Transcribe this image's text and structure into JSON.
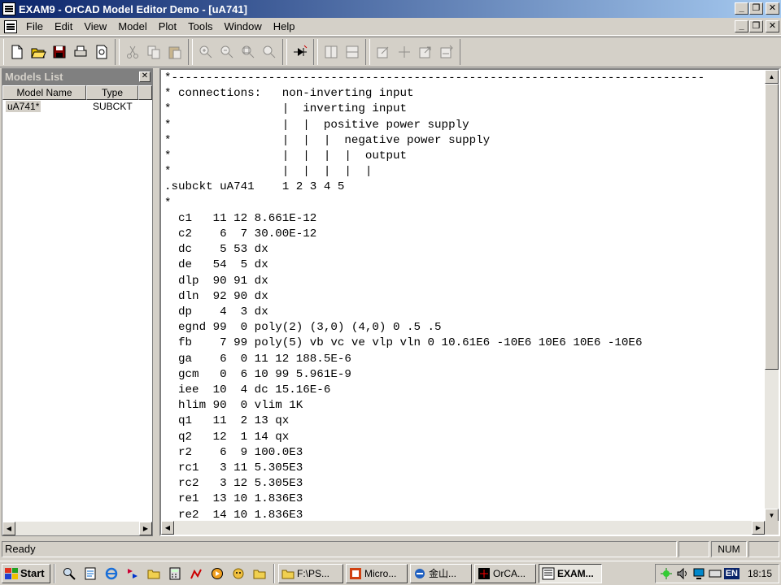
{
  "window": {
    "title": "EXAM9 - OrCAD Model Editor Demo  - [uA741]",
    "minimize": "_",
    "restore": "❐",
    "close": "✕"
  },
  "menu": [
    "File",
    "Edit",
    "View",
    "Model",
    "Plot",
    "Tools",
    "Window",
    "Help"
  ],
  "toolbar_icons": [
    "new-file-icon",
    "open-folder-icon",
    "save-icon",
    "print-icon",
    "print-preview-icon",
    "cut-icon",
    "copy-icon",
    "paste-icon",
    "zoom-in-icon",
    "zoom-out-icon",
    "zoom-area-icon",
    "zoom-fit-icon",
    "diode-model-icon",
    "split-vertical-icon",
    "split-horizontal-icon",
    "edit-trace-icon",
    "crosshair-icon",
    "extract-model-icon",
    "simulate-icon"
  ],
  "models_panel": {
    "title": "Models List",
    "close": "✕",
    "columns": [
      "Model Name",
      "Type"
    ],
    "rows": [
      {
        "name": "uA741*",
        "type": "SUBCKT"
      }
    ]
  },
  "editor": {
    "lines": [
      "*-----------------------------------------------------------------------------",
      "* connections:   non-inverting input",
      "*                |  inverting input",
      "*                |  |  positive power supply",
      "*                |  |  |  negative power supply",
      "*                |  |  |  |  output",
      "*                |  |  |  |  |",
      ".subckt uA741    1 2 3 4 5",
      "*",
      "  c1   11 12 8.661E-12",
      "  c2    6  7 30.00E-12",
      "  dc    5 53 dx",
      "  de   54  5 dx",
      "  dlp  90 91 dx",
      "  dln  92 90 dx",
      "  dp    4  3 dx",
      "  egnd 99  0 poly(2) (3,0) (4,0) 0 .5 .5",
      "  fb    7 99 poly(5) vb vc ve vlp vln 0 10.61E6 -10E6 10E6 10E6 -10E6",
      "  ga    6  0 11 12 188.5E-6",
      "  gcm   0  6 10 99 5.961E-9",
      "  iee  10  4 dc 15.16E-6",
      "  hlim 90  0 vlim 1K",
      "  q1   11  2 13 qx",
      "  q2   12  1 14 qx",
      "  r2    6  9 100.0E3",
      "  rc1   3 11 5.305E3",
      "  rc2   3 12 5.305E3",
      "  re1  13 10 1.836E3",
      "  re2  14 10 1.836E3"
    ]
  },
  "status": {
    "text": "Ready",
    "num": "NUM"
  },
  "taskbar": {
    "start": "Start",
    "tasks": [
      {
        "label": "F:\\PS...",
        "icon": "folder-icon"
      },
      {
        "label": "Micro...",
        "icon": "powerpoint-icon"
      },
      {
        "label": "金山...",
        "icon": "kingsoft-icon"
      },
      {
        "label": "OrCA...",
        "icon": "orcad-icon"
      },
      {
        "label": "EXAM...",
        "icon": "model-editor-icon",
        "active": true
      }
    ],
    "language": "EN",
    "clock": "18:15"
  }
}
